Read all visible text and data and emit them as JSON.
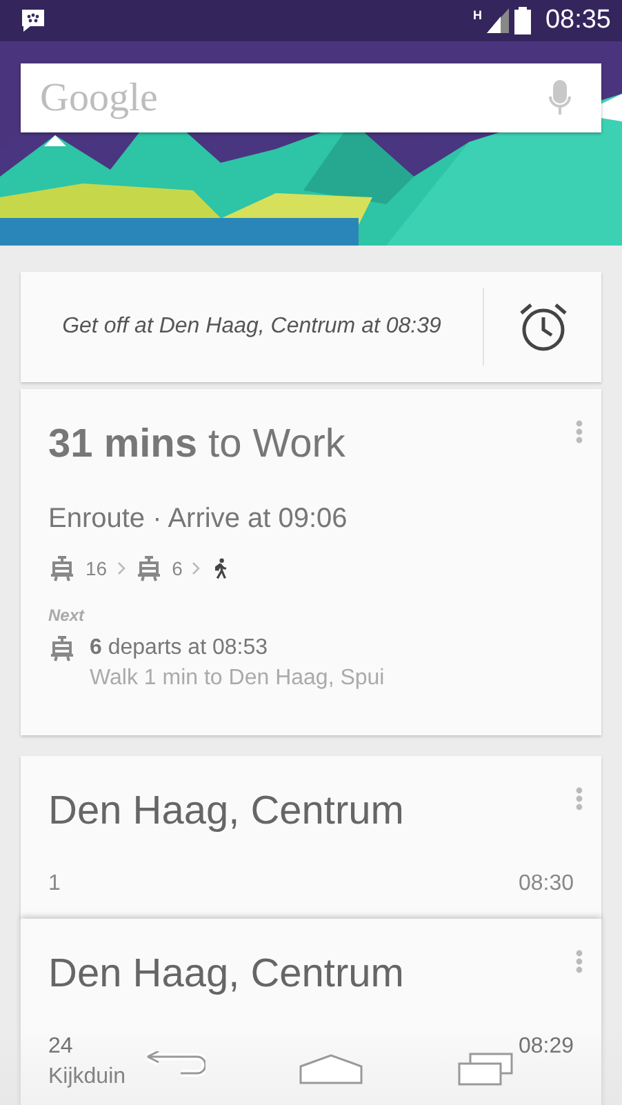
{
  "status_bar": {
    "time": "08:35",
    "network": "H"
  },
  "search": {
    "placeholder": "Google"
  },
  "alarm_card": {
    "text": "Get off at Den Haag, Centrum at 08:39"
  },
  "commute_card": {
    "title": "**31 mins** to Work",
    "status": "Enroute · Arrive at 09:06",
    "route": [
      {
        "kind": "tram",
        "line": "16"
      },
      {
        "kind": "tram",
        "line": "6"
      },
      {
        "kind": "walk"
      }
    ],
    "next_label": "Next",
    "next": {
      "kind": "tram",
      "text": "**6** departs at 08:53",
      "detail": "Walk 1 min to Den Haag, Spui"
    }
  },
  "stations": [
    {
      "name": "Den Haag, Centrum",
      "departures": [
        {
          "line": "1",
          "time": "08:30"
        }
      ]
    },
    {
      "name": "Den Haag, Centrum",
      "departures": [
        {
          "line": "24",
          "time": "08:29",
          "destination": "Kijkduin"
        }
      ]
    }
  ]
}
